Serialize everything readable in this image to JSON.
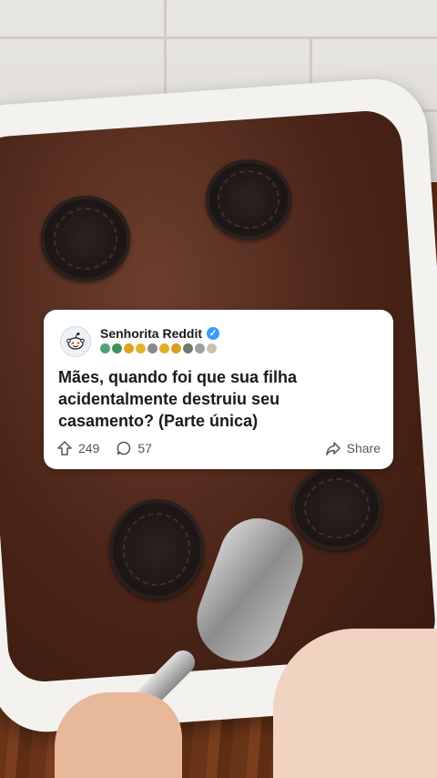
{
  "post": {
    "username": "Senhorita Reddit",
    "title": "Mães, quando foi que sua filha acidentalmente destruiu seu casamento? (Parte única)",
    "upvotes": "249",
    "comments": "57",
    "share_label": "Share"
  },
  "colors": {
    "verified": "#3b9aff",
    "card_bg": "#ffffff",
    "text": "#1a1a1b"
  },
  "icons": [
    "reddit-avatar-icon",
    "verified-icon",
    "upvote-icon",
    "comment-icon",
    "share-icon"
  ]
}
